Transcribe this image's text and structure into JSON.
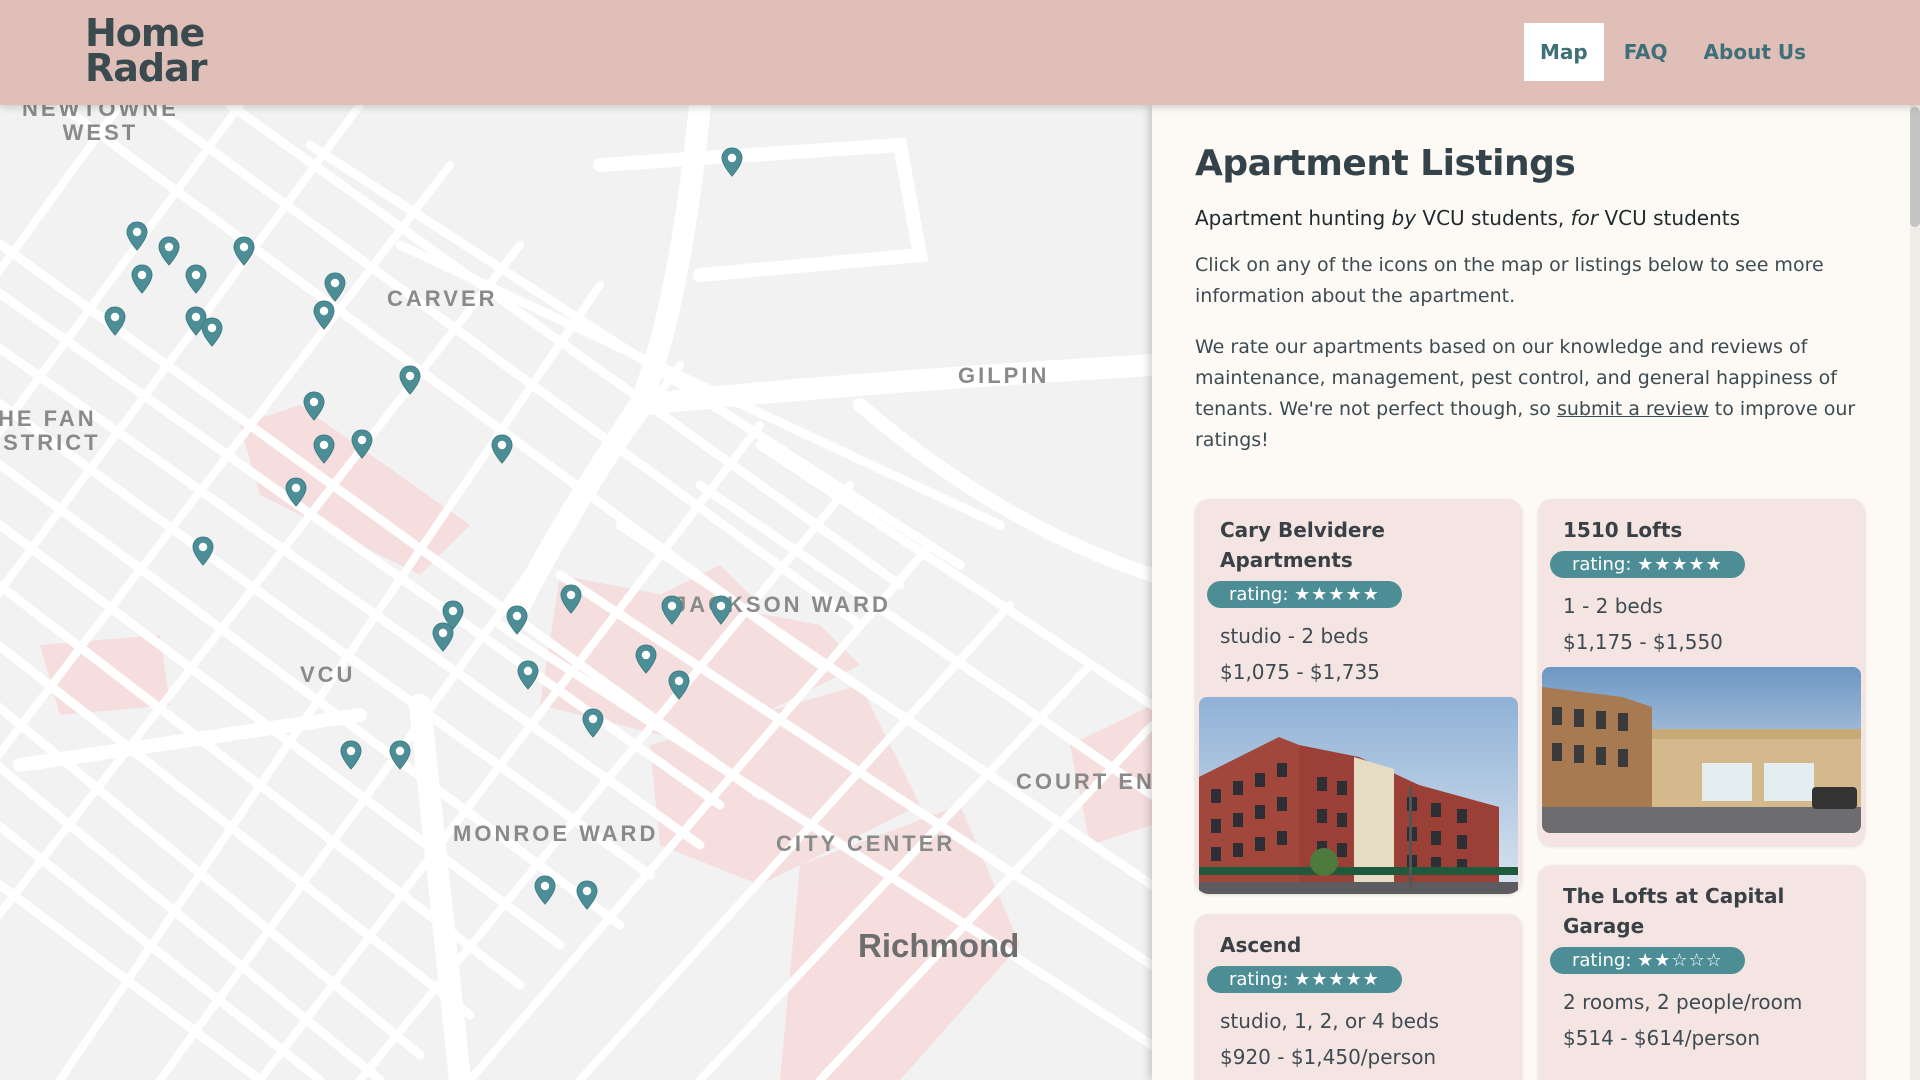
{
  "header": {
    "logo_line1": "Home",
    "logo_line2": "Radar",
    "nav": [
      {
        "label": "Map",
        "active": true
      },
      {
        "label": "FAQ",
        "active": false
      },
      {
        "label": "About Us",
        "active": false
      }
    ]
  },
  "map": {
    "labels": [
      {
        "line1": "NEWTOWNE",
        "line2": "WEST"
      },
      {
        "line1": "CARVER"
      },
      {
        "line1": "GILPIN"
      },
      {
        "line1": "HE FAN",
        "line2": "ISTRICT"
      },
      {
        "line1": "JACKSON WARD"
      },
      {
        "line1": "VCU"
      },
      {
        "line1": "COURT END"
      },
      {
        "line1": "MONROE WARD"
      },
      {
        "line1": "CITY CENTER"
      },
      {
        "line1": "Richmond"
      }
    ],
    "marker_icon": "map-pin-icon",
    "marker_color": "#4d8e96"
  },
  "panel": {
    "title": "Apartment Listings",
    "tagline_a": "Apartment hunting ",
    "tagline_by": "by",
    "tagline_b": " VCU students, ",
    "tagline_for": "for",
    "tagline_c": " VCU students",
    "intro": "Click on any of the icons on the map or listings below to see more information about the apartment.",
    "rating_text_a": "We rate our apartments based on our knowledge and reviews of maintenance, management, pest control, and general happiness of tenants. We're not perfect though, so ",
    "rating_link": "submit a review",
    "rating_text_b": " to improve our ratings!"
  },
  "listings": [
    {
      "name": "Cary Belvidere Apartments",
      "rating_label": "rating:",
      "stars": "★★★★★",
      "rating": 5,
      "beds": "studio - 2 beds",
      "price": "$1,075 - $1,735"
    },
    {
      "name": "1510 Lofts",
      "rating_label": "rating:",
      "stars": "★★★★★",
      "rating": 5,
      "beds": "1 - 2 beds",
      "price": "$1,175 - $1,550"
    },
    {
      "name": "Ascend",
      "rating_label": "rating:",
      "stars": "★★★★★",
      "rating": 5,
      "beds": "studio, 1, 2, or 4 beds",
      "price": "$920 - $1,450/person"
    },
    {
      "name": "The Lofts at Capital Garage",
      "rating_label": "rating:",
      "stars": "★★☆☆☆",
      "rating": 2,
      "beds": "2 rooms, 2 people/room",
      "price": "$514 - $614/person"
    }
  ],
  "colors": {
    "header_bg": "#dfbfb8",
    "accent": "#4d8e96",
    "panel_bg": "#fdf9f5",
    "card_bg": "#f4e5e2"
  }
}
